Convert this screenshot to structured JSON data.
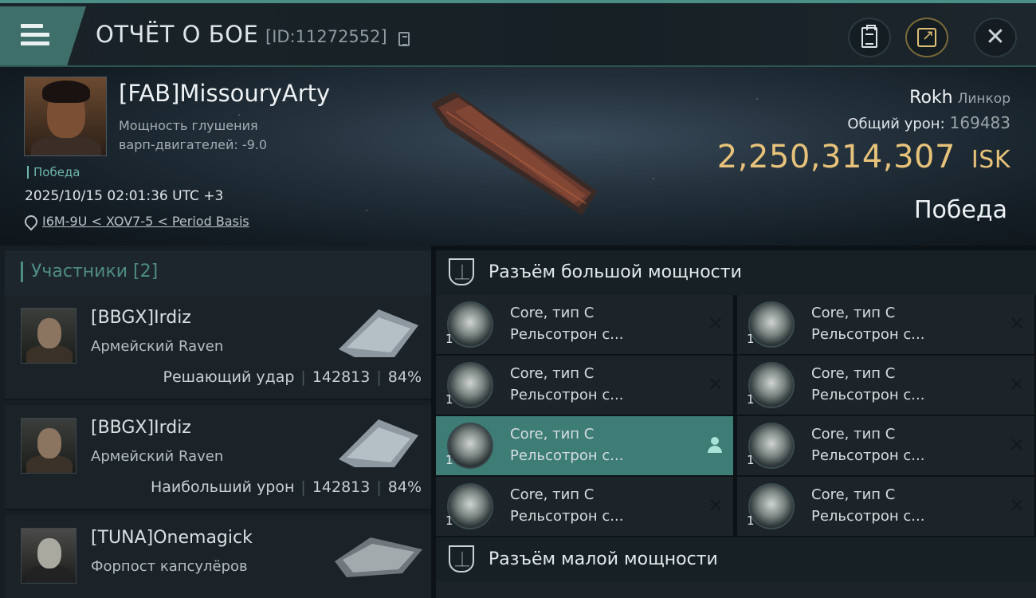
{
  "header": {
    "title": "ОТЧЁТ О БОЕ",
    "report_id": "[ID:11272552]"
  },
  "victim": {
    "name": "[FAB]MissouryArty",
    "warp_label": "Мощность глушения варп-двигателей: -9.0",
    "outcome_tag": "Победа",
    "datetime": "2025/10/15 02:01:36 UTC +3",
    "location": "I6M-9U < XOV7-5 < Period Basis",
    "ship_name": "Rokh",
    "ship_class": "Линкор",
    "damage_label": "Общий урон:",
    "damage_value": "169483",
    "isk_value": "2,250,314,307",
    "isk_unit": "ISK",
    "result": "Победа"
  },
  "participants": {
    "header": "Участники [2]",
    "items": [
      {
        "name": "[BBGX]Irdiz",
        "ship": "Армейский Raven",
        "role": "Решающий удар",
        "damage": "142813",
        "percent": "84%"
      },
      {
        "name": "[BBGX]Irdiz",
        "ship": "Армейский Raven",
        "role": "Наибольший урон",
        "damage": "142813",
        "percent": "84%"
      },
      {
        "name": "[TUNA]Onemagick",
        "ship": "Форпост капсулёров",
        "role": "",
        "damage": "",
        "percent": ""
      }
    ]
  },
  "fittings": {
    "high_slot_label": "Разъём большой мощности",
    "low_slot_label": "Разъём малой мощности",
    "modules": [
      {
        "qty": "1",
        "name": "Core, тип C",
        "type": "Рельсотрон с...",
        "status": "destroyed"
      },
      {
        "qty": "1",
        "name": "Core, тип C",
        "type": "Рельсотрон с...",
        "status": "destroyed"
      },
      {
        "qty": "1",
        "name": "Core, тип C",
        "type": "Рельсотрон с...",
        "status": "destroyed"
      },
      {
        "qty": "1",
        "name": "Core, тип C",
        "type": "Рельсотрон с...",
        "status": "destroyed"
      },
      {
        "qty": "1",
        "name": "Core, тип C",
        "type": "Рельсотрон с...",
        "status": "dropped"
      },
      {
        "qty": "1",
        "name": "Core, тип C",
        "type": "Рельсотрон с...",
        "status": "destroyed"
      },
      {
        "qty": "1",
        "name": "Core, тип C",
        "type": "Рельсотрон с...",
        "status": "destroyed"
      },
      {
        "qty": "1",
        "name": "Core, тип C",
        "type": "Рельсотрон с...",
        "status": "destroyed"
      }
    ],
    "destroyed_glyph": "✕"
  },
  "colors": {
    "accent": "#4f8c85",
    "isk_gold": "#e7c27a",
    "active_module": "#3d7d75"
  },
  "icons": [
    "menu-icon",
    "copy-icon",
    "clipboard-icon",
    "share-icon",
    "close-icon",
    "location-pin-icon",
    "high-slot-icon",
    "low-slot-icon",
    "module-icon",
    "pilot-icon"
  ]
}
